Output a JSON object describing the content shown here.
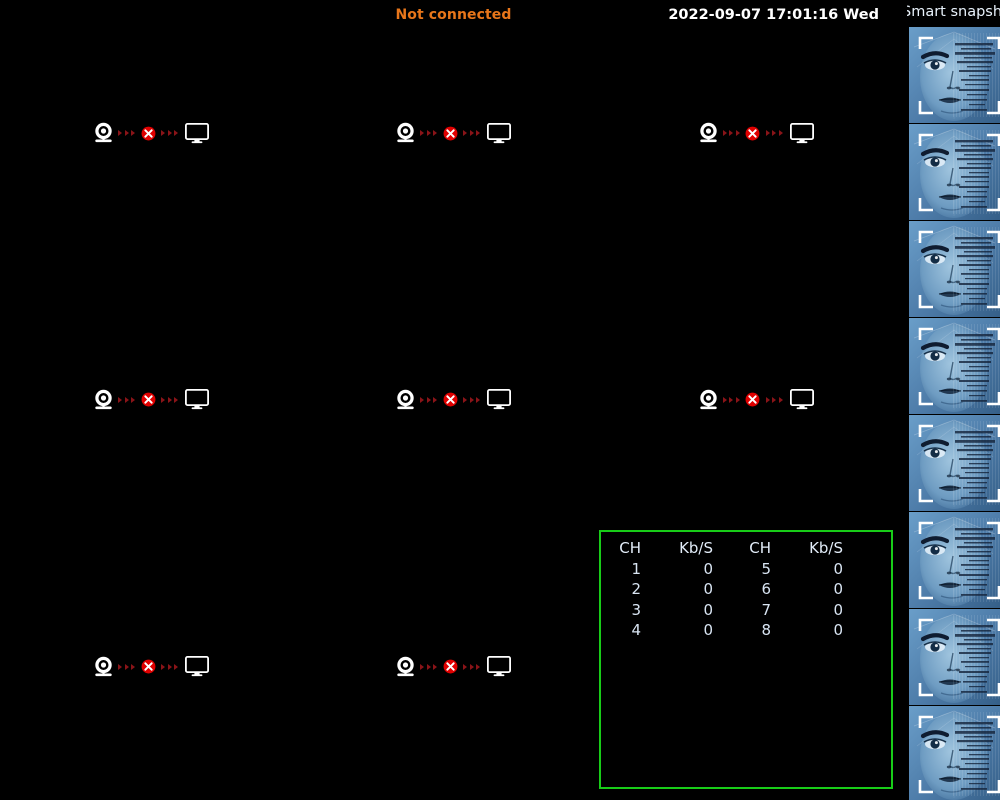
{
  "topbar": {
    "status": "Not connected",
    "datetime": "2022-09-07 17:01:16 Wed"
  },
  "video_grid": {
    "rows": 3,
    "cols": 3,
    "channels": [
      {
        "id": 1,
        "state": "disconnected",
        "camera_icon": "dome-camera-icon",
        "link_icon": "red-x-disconnect-icon",
        "monitor_icon": "monitor-icon"
      },
      {
        "id": 2,
        "state": "disconnected",
        "camera_icon": "dome-camera-icon",
        "link_icon": "red-x-disconnect-icon",
        "monitor_icon": "monitor-icon"
      },
      {
        "id": 3,
        "state": "disconnected",
        "camera_icon": "dome-camera-icon",
        "link_icon": "red-x-disconnect-icon",
        "monitor_icon": "monitor-icon"
      },
      {
        "id": 4,
        "state": "disconnected",
        "camera_icon": "dome-camera-icon",
        "link_icon": "red-x-disconnect-icon",
        "monitor_icon": "monitor-icon"
      },
      {
        "id": 5,
        "state": "disconnected",
        "camera_icon": "dome-camera-icon",
        "link_icon": "red-x-disconnect-icon",
        "monitor_icon": "monitor-icon"
      },
      {
        "id": 6,
        "state": "disconnected",
        "camera_icon": "dome-camera-icon",
        "link_icon": "red-x-disconnect-icon",
        "monitor_icon": "monitor-icon"
      },
      {
        "id": 7,
        "state": "disconnected",
        "camera_icon": "dome-camera-icon",
        "link_icon": "red-x-disconnect-icon",
        "monitor_icon": "monitor-icon"
      },
      {
        "id": 8,
        "state": "disconnected",
        "camera_icon": "dome-camera-icon",
        "link_icon": "red-x-disconnect-icon",
        "monitor_icon": "monitor-icon"
      },
      {
        "id": 9,
        "state": "covered",
        "camera_icon": "",
        "link_icon": "",
        "monitor_icon": ""
      }
    ]
  },
  "bandwidth": {
    "border_color": "#18cc18",
    "headers": [
      "CH",
      "Kb/S",
      "CH",
      "Kb/S"
    ],
    "rows": [
      {
        "ch_left": "1",
        "kbs_left": "0",
        "ch_right": "5",
        "kbs_right": "0"
      },
      {
        "ch_left": "2",
        "kbs_left": "0",
        "ch_right": "6",
        "kbs_right": "0"
      },
      {
        "ch_left": "3",
        "kbs_left": "0",
        "ch_right": "7",
        "kbs_right": "0"
      },
      {
        "ch_left": "4",
        "kbs_left": "0",
        "ch_right": "8",
        "kbs_right": "0"
      }
    ]
  },
  "snapshot_panel": {
    "title": "Smart snapshot",
    "thumbnails": [
      {
        "index": 1,
        "type": "face-snapshot"
      },
      {
        "index": 2,
        "type": "face-snapshot"
      },
      {
        "index": 3,
        "type": "face-snapshot"
      },
      {
        "index": 4,
        "type": "face-snapshot"
      },
      {
        "index": 5,
        "type": "face-snapshot"
      },
      {
        "index": 6,
        "type": "face-snapshot"
      },
      {
        "index": 7,
        "type": "face-snapshot"
      },
      {
        "index": 8,
        "type": "face-snapshot"
      }
    ]
  },
  "colors": {
    "background": "#000000",
    "status_orange": "#e8761a",
    "bandwidth_green": "#18cc18",
    "table_text": "#d8e4f2",
    "snapshot_blue": "#5b8fc0"
  }
}
